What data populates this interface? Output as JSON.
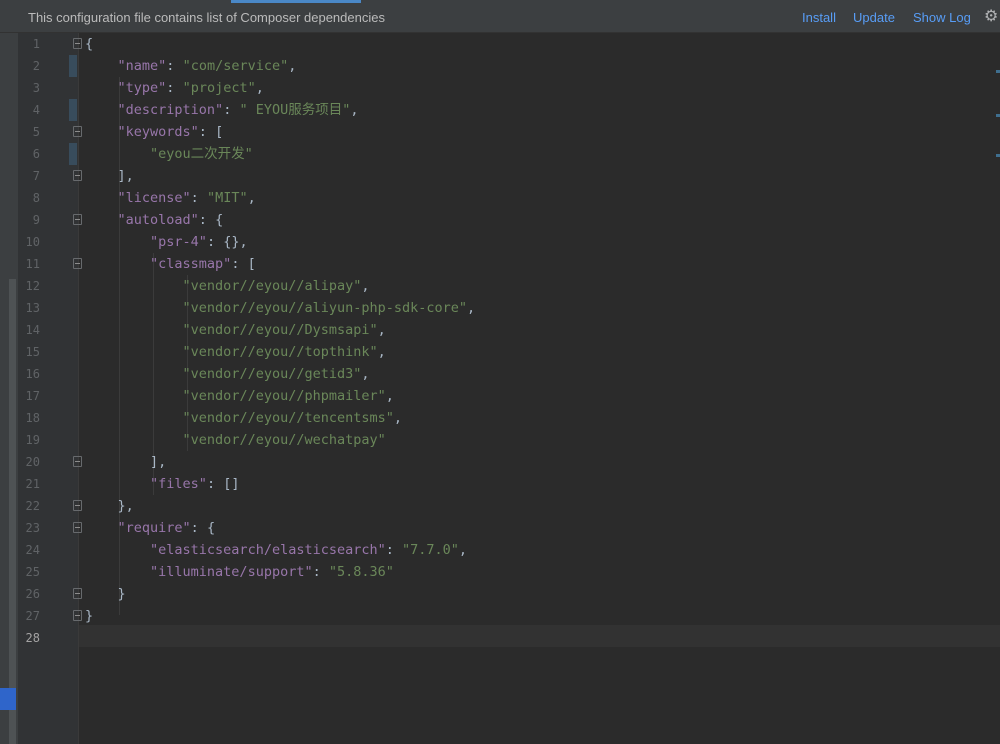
{
  "notification": {
    "message": "This configuration file contains list of Composer dependencies",
    "install_label": "Install",
    "update_label": "Update",
    "show_log_label": "Show Log"
  },
  "colors": {
    "key": "#9876aa",
    "string": "#6a8759",
    "punct": "#a9b7c6",
    "link": "#589df6",
    "background": "#2b2b2b"
  },
  "icons": {
    "settings": "gear-icon",
    "fold": "fold-marker-icon"
  },
  "gutter": {
    "line_numbers": [
      "1",
      "2",
      "3",
      "4",
      "5",
      "6",
      "7",
      "8",
      "9",
      "10",
      "11",
      "12",
      "13",
      "14",
      "15",
      "16",
      "17",
      "18",
      "19",
      "20",
      "21",
      "22",
      "23",
      "24",
      "25",
      "26",
      "27",
      "28"
    ],
    "current_line": "28"
  },
  "code": {
    "l1": "{",
    "l2_key": "\"name\"",
    "l2_val": "\"com/service\"",
    "l3_key": "\"type\"",
    "l3_val": "\"project\"",
    "l4_key": "\"description\"",
    "l4_val": "\" EYOU服务项目\"",
    "l5_key": "\"keywords\"",
    "l5_open": "[",
    "l6_val": "\"eyou二次开发\"",
    "l7": "],",
    "l8_key": "\"license\"",
    "l8_val": "\"MIT\"",
    "l9_key": "\"autoload\"",
    "l9_open": "{",
    "l10_key": "\"psr-4\"",
    "l10_val": "{}",
    "l11_key": "\"classmap\"",
    "l11_open": "[",
    "l12_val": "\"vendor//eyou//alipay\"",
    "l13_val": "\"vendor//eyou//aliyun-php-sdk-core\"",
    "l14_val": "\"vendor//eyou//Dysmsapi\"",
    "l15_val": "\"vendor//eyou//topthink\"",
    "l16_val": "\"vendor//eyou//getid3\"",
    "l17_val": "\"vendor//eyou//phpmailer\"",
    "l18_val": "\"vendor//eyou//tencentsms\"",
    "l19_val": "\"vendor//eyou//wechatpay\"",
    "l20": "],",
    "l21_key": "\"files\"",
    "l21_val": "[]",
    "l22": "},",
    "l23_key": "\"require\"",
    "l23_open": "{",
    "l24_key": "\"elasticsearch/elasticsearch\"",
    "l24_val": "\"7.7.0\"",
    "l25_key": "\"illuminate/support\"",
    "l25_val": "\"5.8.36\"",
    "l26": "}",
    "l27": "}"
  }
}
